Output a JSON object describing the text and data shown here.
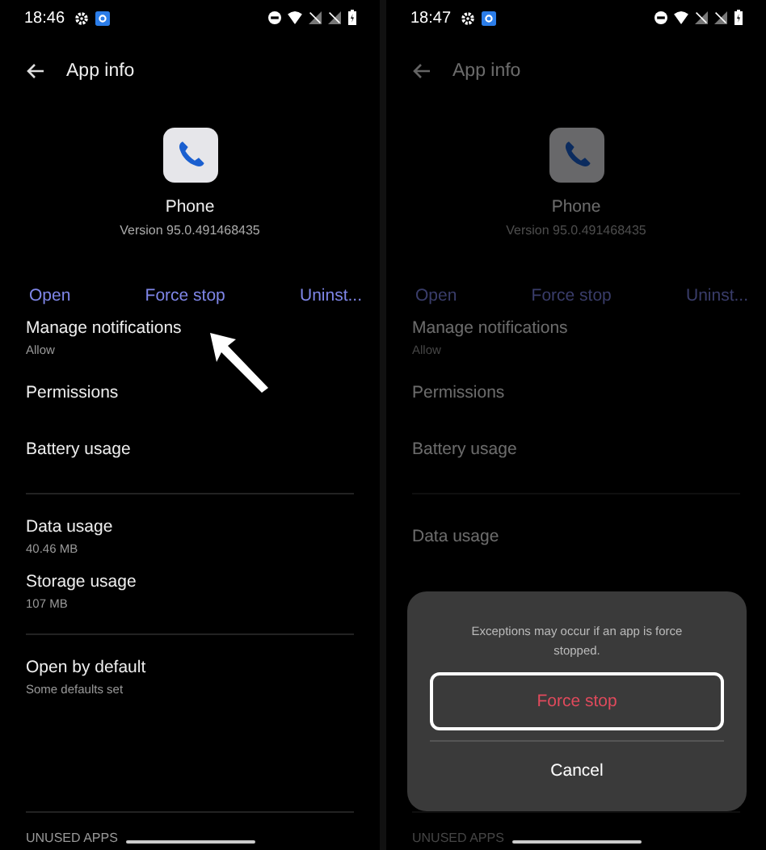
{
  "screens": [
    {
      "time": "18:46",
      "title": "App info",
      "app_name": "Phone",
      "version": "Version 95.0.491468435",
      "dimmed": false,
      "pointer_arrow": true,
      "actions": [
        "Open",
        "Force stop",
        "Uninst..."
      ],
      "groups": [
        [
          {
            "title": "Manage notifications",
            "subtitle": "Allow"
          },
          {
            "title": "Permissions"
          },
          {
            "title": "Battery usage"
          }
        ],
        [
          {
            "title": "Data usage",
            "subtitle": "40.46 MB"
          },
          {
            "title": "Storage usage",
            "subtitle": "107 MB"
          }
        ],
        [
          {
            "title": "Open by default",
            "subtitle": "Some defaults set"
          }
        ]
      ],
      "section_header": "UNUSED APPS"
    },
    {
      "time": "18:47",
      "title": "App info",
      "app_name": "Phone",
      "version": "Version 95.0.491468435",
      "dimmed": true,
      "actions": [
        "Open",
        "Force stop",
        "Uninst..."
      ],
      "groups": [
        [
          {
            "title": "Manage notifications",
            "subtitle": "Allow"
          },
          {
            "title": "Permissions"
          },
          {
            "title": "Battery usage"
          }
        ],
        [
          {
            "title": "Data usage"
          }
        ]
      ],
      "section_header": "UNUSED APPS",
      "dialog": {
        "message": "Exceptions may occur if an app is force stopped.",
        "confirm": "Force stop",
        "cancel": "Cancel"
      }
    }
  ]
}
